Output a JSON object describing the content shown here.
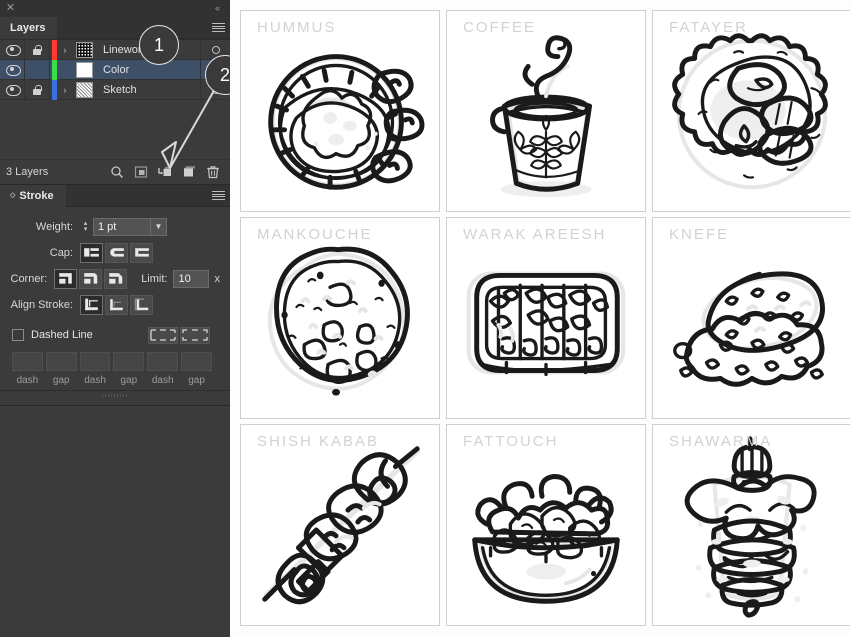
{
  "window": {
    "close_label": "✕",
    "collapse_label": "«"
  },
  "layers_panel": {
    "tab_label": "Layers",
    "menu_label": "≡",
    "columns": {
      "eye": "visibility",
      "lock": "lock",
      "target": "target"
    },
    "rows": [
      {
        "name": "Linework",
        "visible": true,
        "locked": true,
        "color": "#ff3b30",
        "has_children": true,
        "thumb": "linework",
        "selected": false,
        "expand_glyph": "›"
      },
      {
        "name": "Color",
        "visible": true,
        "locked": false,
        "color": "#3cdb4a",
        "has_children": false,
        "thumb": "blank",
        "selected": true,
        "expand_glyph": ""
      },
      {
        "name": "Sketch",
        "visible": true,
        "locked": true,
        "color": "#3b6fe0",
        "has_children": true,
        "thumb": "sketch",
        "selected": false,
        "expand_glyph": "›"
      }
    ],
    "footer": {
      "count_label": "3 Layers",
      "icons": [
        "locate-object-icon",
        "make-clipping-mask-icon",
        "create-new-sublayer-icon",
        "create-new-layer-icon",
        "delete-selection-icon"
      ]
    }
  },
  "stroke_panel": {
    "tab_label": "Stroke",
    "menu_label": "≡",
    "weight": {
      "label": "Weight:",
      "value": "1 pt"
    },
    "cap": {
      "label": "Cap:",
      "options": [
        "butt-cap",
        "round-cap",
        "projecting-cap"
      ],
      "selected": 0
    },
    "corner": {
      "label": "Corner:",
      "options": [
        "miter-join",
        "round-join",
        "bevel-join"
      ],
      "selected": 0
    },
    "limit": {
      "label": "Limit:",
      "value": "10",
      "unit": "x"
    },
    "align_stroke": {
      "label": "Align Stroke:",
      "options": [
        "align-center",
        "align-inside",
        "align-outside"
      ],
      "selected": 0
    },
    "dashed_line": {
      "label": "Dashed Line",
      "checked": false
    },
    "dash_align_options": [
      "dashes-preserve-exact-lengths",
      "dashes-adjust-to-corners"
    ],
    "dash_fields": [
      {
        "caption": "dash",
        "value": ""
      },
      {
        "caption": "gap",
        "value": ""
      },
      {
        "caption": "dash",
        "value": ""
      },
      {
        "caption": "gap",
        "value": ""
      },
      {
        "caption": "dash",
        "value": ""
      },
      {
        "caption": "gap",
        "value": ""
      }
    ]
  },
  "callouts": [
    {
      "id": 1,
      "label": "1"
    },
    {
      "id": 2,
      "label": "2"
    }
  ],
  "artboards": [
    {
      "label": "HUMMUS",
      "icon": "hummus-plate-illustration"
    },
    {
      "label": "COFFEE",
      "icon": "coffee-cup-illustration"
    },
    {
      "label": "FATAYER",
      "icon": "fatayer-platter-illustration"
    },
    {
      "label": "MANKOUCHE",
      "icon": "mankouche-flatbread-illustration"
    },
    {
      "label": "WARAK AREESH",
      "icon": "stuffed-grape-leaves-illustration"
    },
    {
      "label": "KNEFE",
      "icon": "knefe-dessert-illustration"
    },
    {
      "label": "SHISH KABAB",
      "icon": "shish-kabab-skewer-illustration"
    },
    {
      "label": "FATTOUCH",
      "icon": "fattouch-salad-bowl-illustration"
    },
    {
      "label": "SHAWARMA",
      "icon": "shawarma-spit-illustration"
    }
  ],
  "colors": {
    "panel_bg": "#3b3b3b",
    "panel_header_bg": "#323232",
    "selection_blue": "#3d5068",
    "canvas_bg": "#fdfdfd",
    "ink": "#1a1a1a",
    "label_gray": "#d2d2d2"
  }
}
